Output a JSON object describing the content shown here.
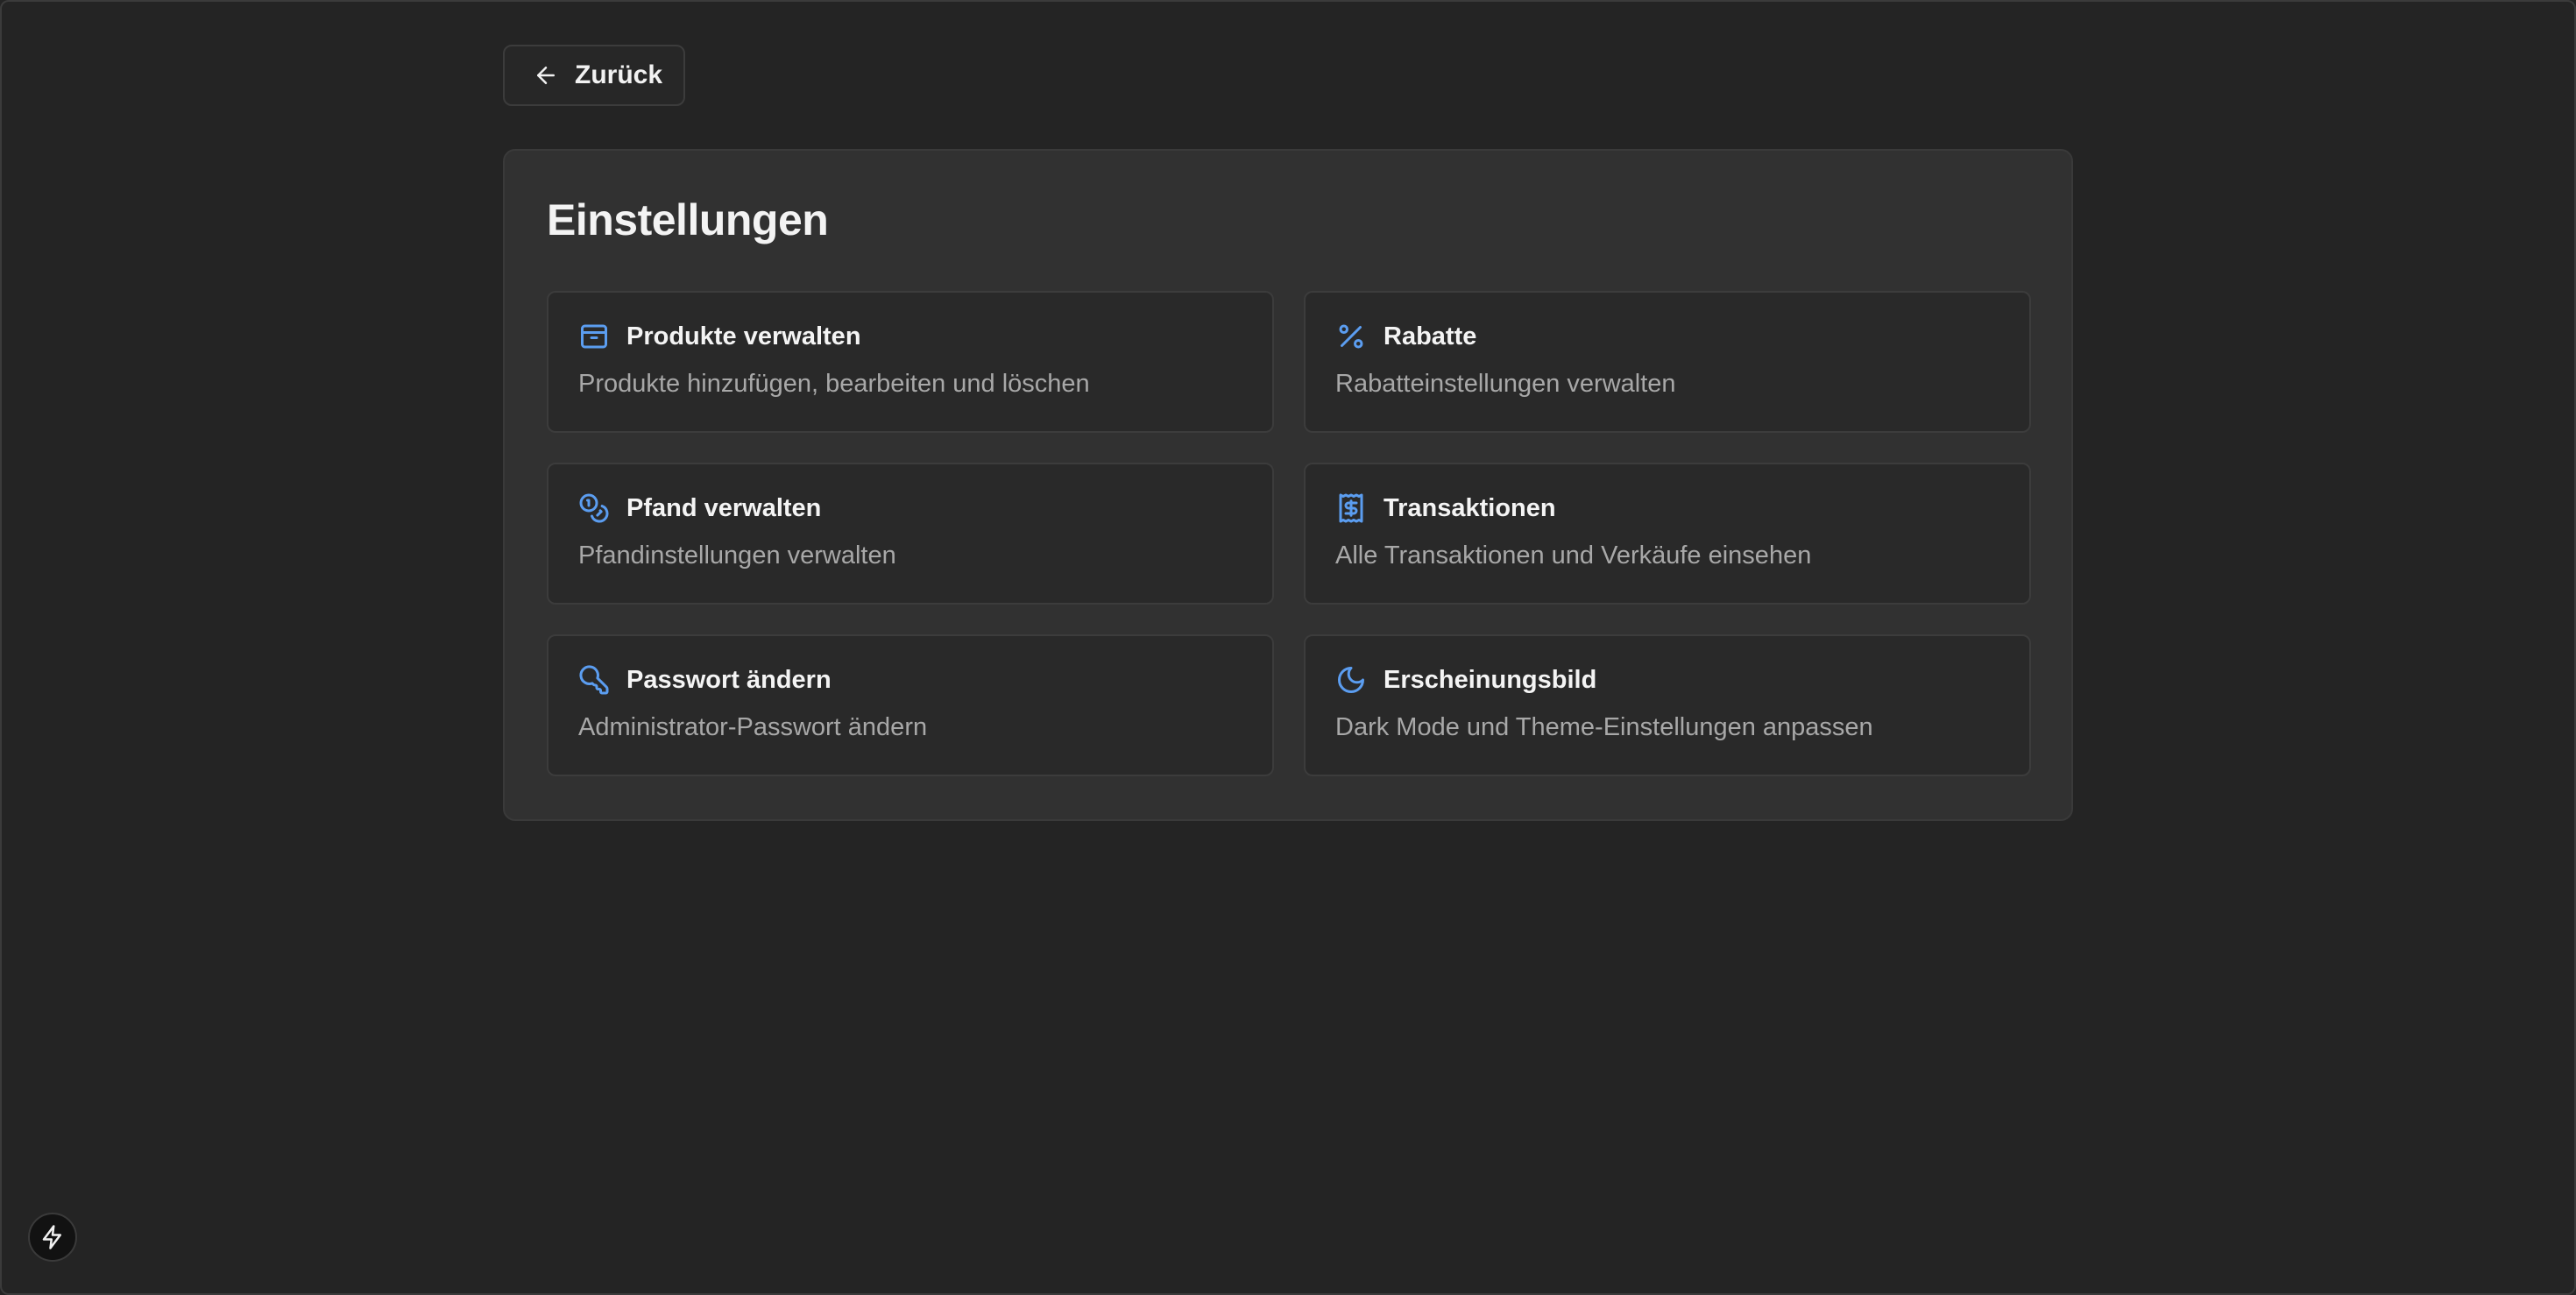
{
  "colors": {
    "background": "#242424",
    "card": "#313131",
    "tile": "#292929",
    "accent": "#5b9df0",
    "text": "#f2f2f2",
    "muted": "#a8a8a8"
  },
  "header": {
    "back_label": "Zurück",
    "back_icon": "arrow-left-icon"
  },
  "settings": {
    "title": "Einstellungen",
    "tiles": [
      {
        "icon": "package-icon",
        "title": "Produkte verwalten",
        "description": "Produkte hinzufügen, bearbeiten und löschen"
      },
      {
        "icon": "percent-icon",
        "title": "Rabatte",
        "description": "Rabatteinstellungen verwalten"
      },
      {
        "icon": "coins-icon",
        "title": "Pfand verwalten",
        "description": "Pfandinstellungen verwalten"
      },
      {
        "icon": "receipt-icon",
        "title": "Transaktionen",
        "description": "Alle Transaktionen und Verkäufe einsehen"
      },
      {
        "icon": "key-icon",
        "title": "Passwort ändern",
        "description": "Administrator-Passwort ändern"
      },
      {
        "icon": "moon-icon",
        "title": "Erscheinungsbild",
        "description": "Dark Mode und Theme-Einstellungen anpassen"
      }
    ]
  },
  "footer": {
    "badge_icon": "lightning-icon"
  }
}
